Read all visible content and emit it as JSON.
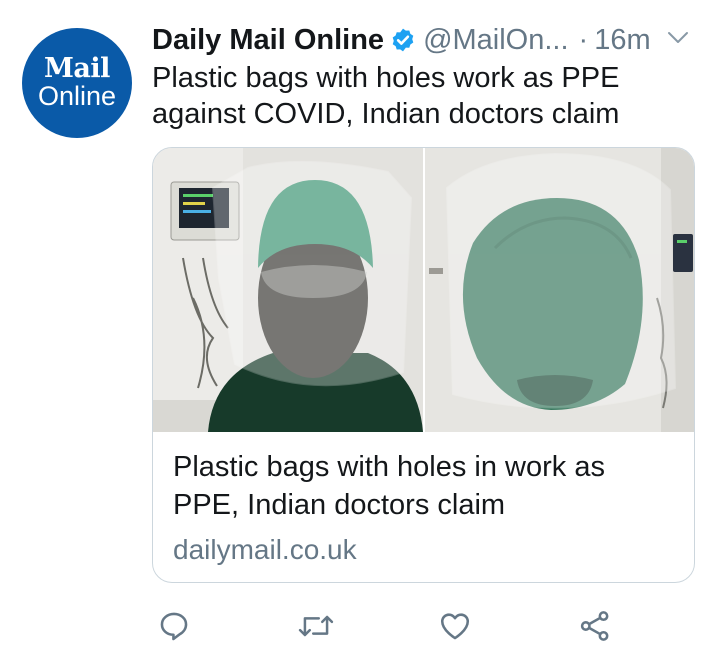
{
  "tweet": {
    "author_avatar": {
      "line1": "Mail",
      "line2": "Online"
    },
    "author_name": "Daily Mail Online",
    "handle": "@MailOn...",
    "separator": "·",
    "time": "16m",
    "text": "Plastic bags with holes work as PPE against COVID, Indian doctors claim",
    "card": {
      "title": "Plastic bags with holes in work as PPE, Indian doctors claim",
      "domain": "dailymail.co.uk"
    },
    "icons": {
      "verified": "verified-badge-icon",
      "menu": "chevron-down-icon",
      "reply": "reply-icon",
      "retweet": "retweet-icon",
      "like": "heart-icon",
      "share": "share-icon"
    }
  },
  "colors": {
    "brand_blue": "#0a5aa8",
    "verified_blue": "#1da1f2",
    "secondary_text": "#657786",
    "primary_text": "#14171a",
    "border": "#ccd6dd"
  }
}
